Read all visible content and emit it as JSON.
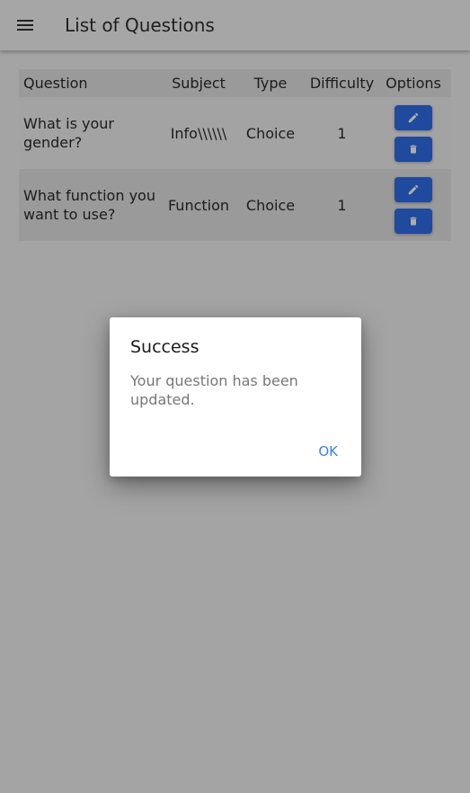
{
  "appbar": {
    "title": "List of Questions",
    "menu_icon": "menu-icon"
  },
  "table": {
    "headers": {
      "question": "Question",
      "subject": "Subject",
      "type": "Type",
      "difficulty": "Difficulty",
      "options": "Options"
    },
    "rows": [
      {
        "question": "What is your gender?",
        "subject": "Info\\\\\\\\\\\\",
        "type": "Choice",
        "difficulty": "1"
      },
      {
        "question": "What function you want to use?",
        "subject": "Function",
        "type": "Choice",
        "difficulty": "1"
      }
    ],
    "edit_icon": "pencil-icon",
    "delete_icon": "trash-icon"
  },
  "dialog": {
    "title": "Success",
    "message": "Your question has been updated.",
    "ok_label": "OK"
  },
  "colors": {
    "primary_button": "#2f6de8",
    "dialog_action": "#3f7ef2",
    "scrim": "rgba(0,0,0,0.32)"
  }
}
